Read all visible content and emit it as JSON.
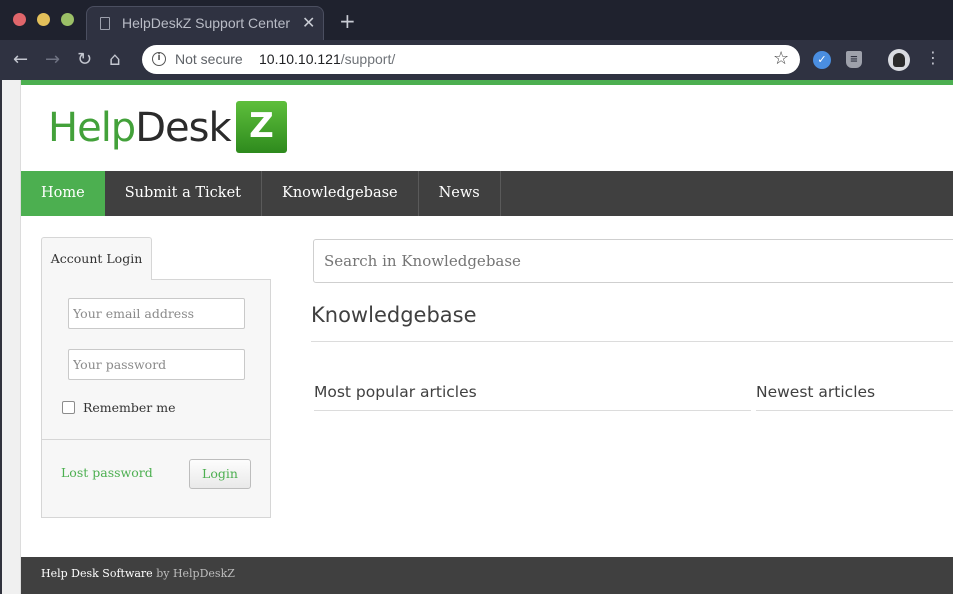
{
  "browser": {
    "tab_title": "HelpDeskZ Support Center",
    "tab_close": "✕",
    "new_tab": "+",
    "security_label": "Not secure",
    "url_host": "10.10.10.121",
    "url_path": "/support/"
  },
  "site": {
    "logo": {
      "part1": "Help",
      "part2": "Desk",
      "box_letter": "Z"
    },
    "nav": [
      {
        "label": "Home",
        "active": true
      },
      {
        "label": "Submit a Ticket",
        "active": false
      },
      {
        "label": "Knowledgebase",
        "active": false
      },
      {
        "label": "News",
        "active": false
      }
    ],
    "login": {
      "tab_label": "Account Login",
      "email_placeholder": "Your email address",
      "password_placeholder": "Your password",
      "remember_label": "Remember me",
      "lost_password": "Lost password",
      "login_button": "Login"
    },
    "kb": {
      "search_placeholder": "Search in Knowledgebase",
      "title": "Knowledgebase",
      "popular_title": "Most popular articles",
      "newest_title": "Newest articles"
    },
    "footer": {
      "software": "Help Desk Software",
      "by": "by HelpDeskZ"
    }
  },
  "colors": {
    "accent": "#4caf50",
    "nav_bg": "#404040",
    "footer_bg": "#404040"
  }
}
